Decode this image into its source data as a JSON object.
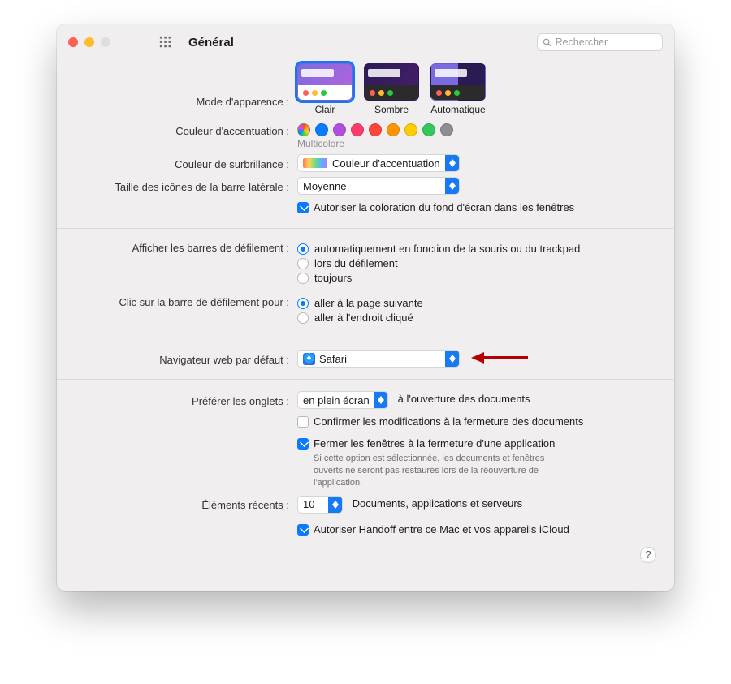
{
  "titlebar": {
    "title": "Général"
  },
  "search": {
    "placeholder": "Rechercher"
  },
  "labels": {
    "appearance": "Mode d'apparence :",
    "accent": "Couleur d'accentuation :",
    "accent_sub": "Multicolore",
    "highlight": "Couleur de surbrillance :",
    "sidebar_size": "Taille des icônes de la barre latérale :",
    "scrollbars": "Afficher les barres de défilement :",
    "scroll_click": "Clic sur la barre de défilement pour :",
    "default_browser": "Navigateur web par défaut :",
    "prefer_tabs": "Préférer les onglets :",
    "recent_items": "Éléments récents :"
  },
  "appearance": {
    "light": "Clair",
    "dark": "Sombre",
    "auto": "Automatique"
  },
  "highlight_value": "Couleur d'accentuation",
  "sidebar_size_value": "Moyenne",
  "allow_tint": "Autoriser la coloration du fond d'écran dans les fenêtres",
  "scroll": {
    "auto": "automatiquement en fonction de la souris ou du trackpad",
    "when_scrolling": "lors du défilement",
    "always": "toujours"
  },
  "scroll_click": {
    "next_page": "aller à la page suivante",
    "click_pos": "aller à l'endroit cliqué"
  },
  "browser_value": "Safari",
  "prefer_tabs_value": "en plein écran",
  "prefer_tabs_suffix": "à l'ouverture des documents",
  "confirm_close": "Confirmer les modifications à la fermeture des documents",
  "close_windows": "Fermer les fenêtres à la fermeture d'une application",
  "close_windows_help": "Si cette option est sélectionnée, les documents et fenêtres ouverts ne seront pas restaurés lors de la réouverture de l'application.",
  "recent_value": "10",
  "recent_suffix": "Documents, applications et serveurs",
  "handoff": "Autoriser Handoff entre ce Mac et vos appareils iCloud",
  "accent_colors": [
    "#0a7aff",
    "#b150de",
    "#ff3b6b",
    "#ff453a",
    "#ff9500",
    "#ffcc00",
    "#34c759",
    "#8e8e93"
  ]
}
